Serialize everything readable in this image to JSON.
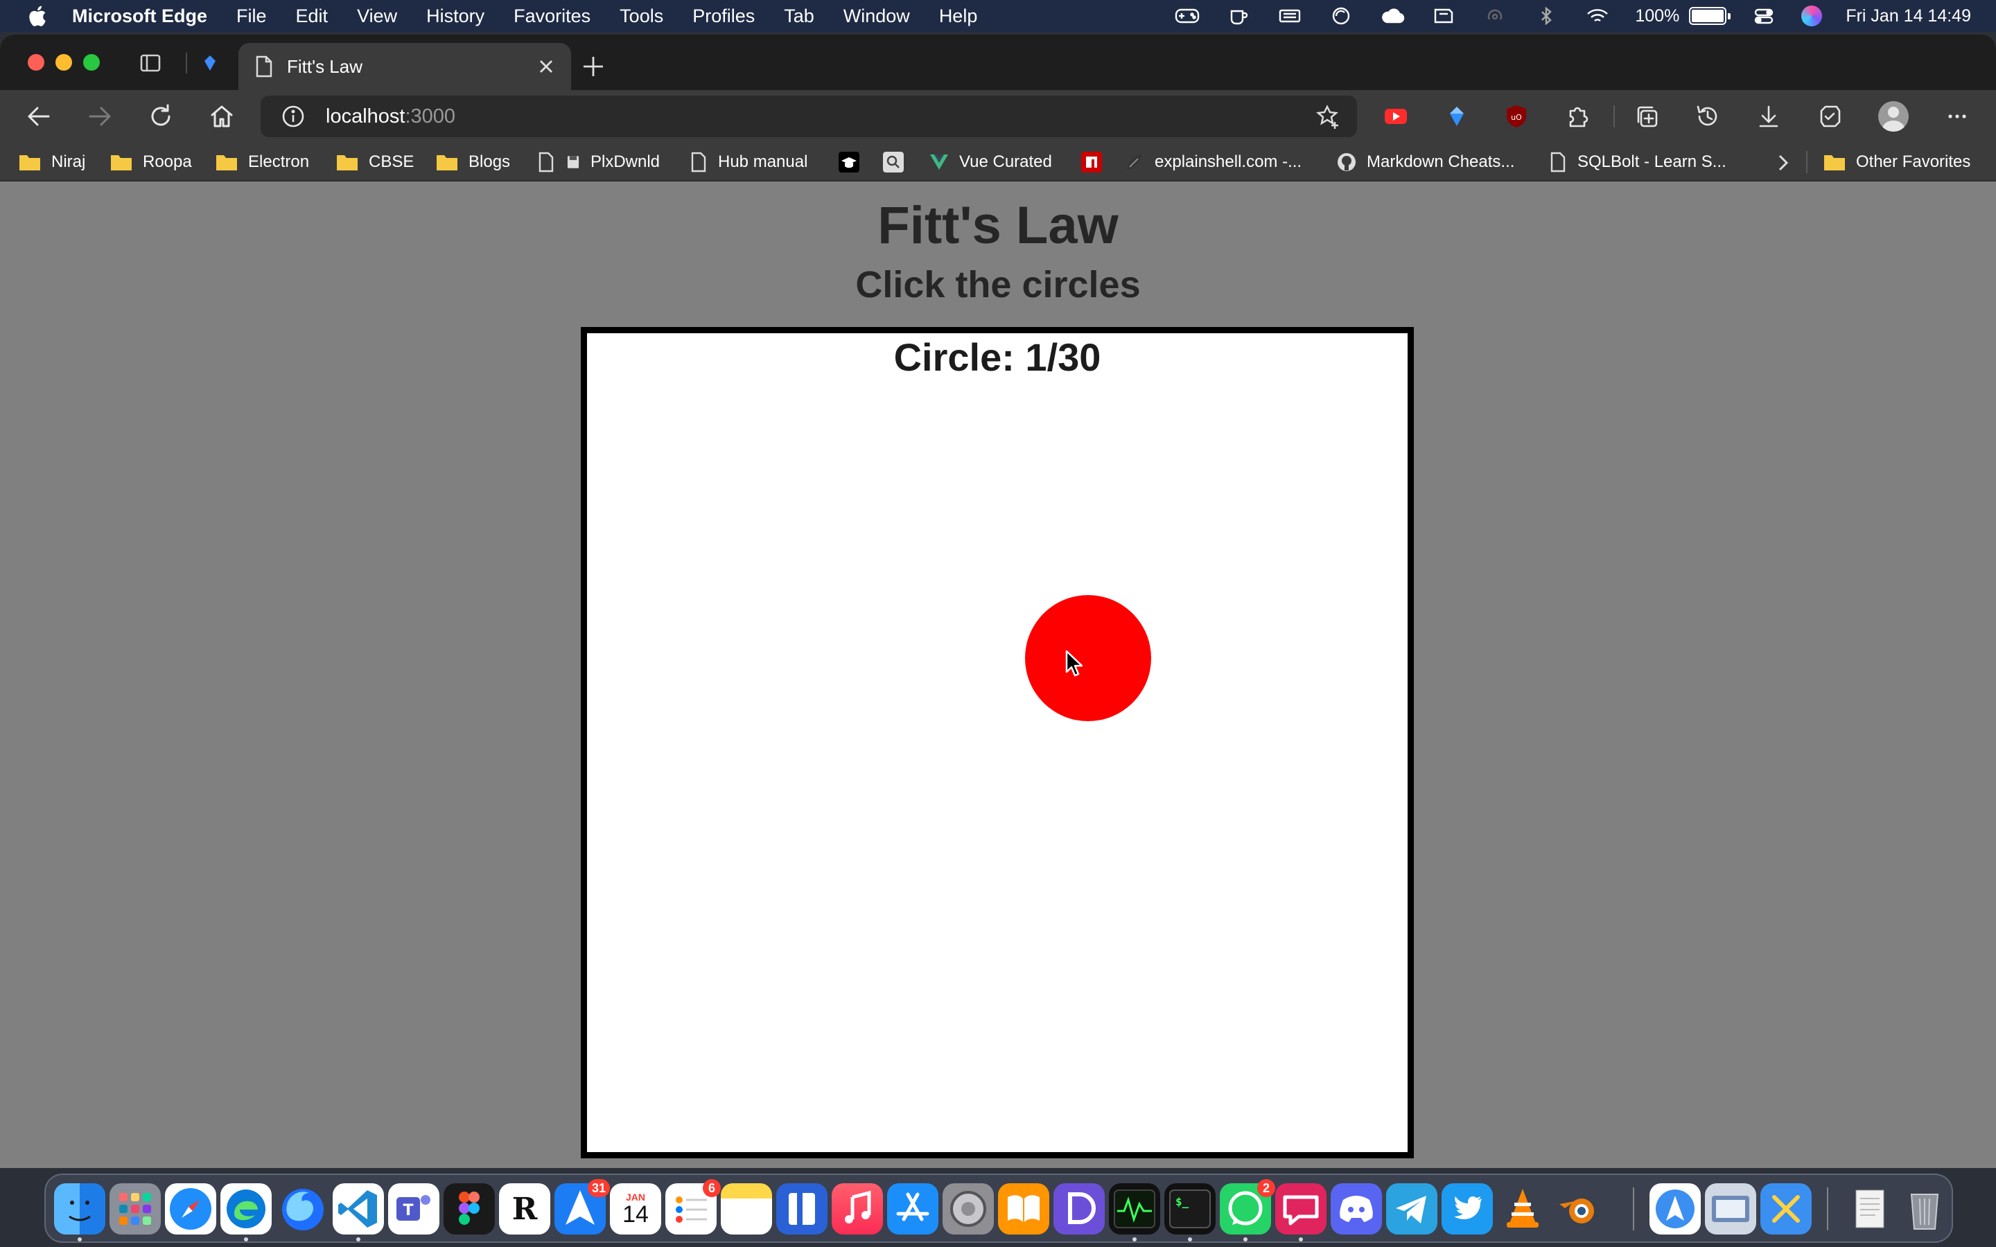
{
  "menubar": {
    "app_name": "Microsoft Edge",
    "items": [
      "File",
      "Edit",
      "View",
      "History",
      "Favorites",
      "Tools",
      "Profiles",
      "Tab",
      "Window",
      "Help"
    ],
    "battery": "100%",
    "datetime": "Fri Jan 14  14:49"
  },
  "browser": {
    "tab_title": "Fitt's Law",
    "address_host": "localhost",
    "address_port": ":3000",
    "bookmarks": [
      "Niraj",
      "Roopa",
      "Electron",
      "CBSE",
      "Blogs",
      "PlxDwnld",
      "Hub manual",
      "Vue Curated",
      "explainshell.com -...",
      "Markdown Cheats...",
      "SQLBolt - Learn S...",
      "Other Favorites"
    ]
  },
  "page": {
    "title": "Fitt's Law",
    "subtitle": "Click the circles",
    "counter_label": "Circle: 1/30",
    "target_color": "#ff0000"
  },
  "dock": {
    "badges": {
      "testflight": "31",
      "reminders": "6",
      "whatsapp": "2"
    },
    "calendar_month": "JAN",
    "calendar_day": "14"
  }
}
